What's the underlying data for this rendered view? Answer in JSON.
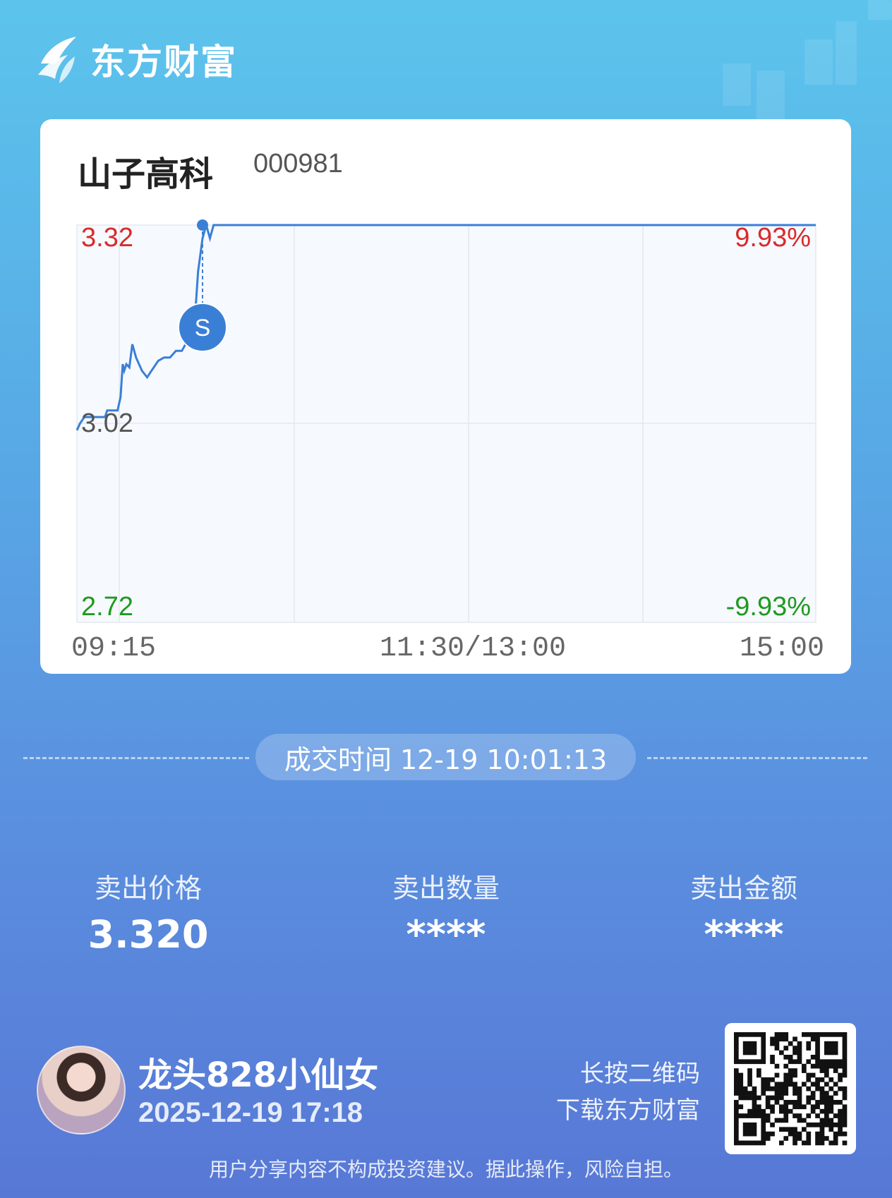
{
  "brand": {
    "name": "东方财富",
    "logo_icon": "eastmoney-logo-icon"
  },
  "stock": {
    "name": "山子高科",
    "code": "000981"
  },
  "chart_data": {
    "type": "line",
    "x_ticks": [
      "09:15",
      "11:30/13:00",
      "15:00"
    ],
    "y_left": {
      "high": "3.32",
      "mid": "3.02",
      "low": "2.72"
    },
    "y_right": {
      "high": "9.93%",
      "low": "-9.93%"
    },
    "ylim": [
      2.72,
      3.32
    ],
    "series": [
      {
        "points": [
          [
            0.0,
            3.01
          ],
          [
            0.004,
            3.02
          ],
          [
            0.01,
            3.03
          ],
          [
            0.038,
            3.03
          ],
          [
            0.041,
            3.04
          ],
          [
            0.055,
            3.04
          ],
          [
            0.059,
            3.06
          ],
          [
            0.062,
            3.11
          ],
          [
            0.064,
            3.1
          ],
          [
            0.067,
            3.11
          ],
          [
            0.071,
            3.105
          ],
          [
            0.075,
            3.14
          ],
          [
            0.08,
            3.12
          ],
          [
            0.088,
            3.1
          ],
          [
            0.095,
            3.09
          ],
          [
            0.101,
            3.1
          ],
          [
            0.11,
            3.115
          ],
          [
            0.118,
            3.12
          ],
          [
            0.126,
            3.12
          ],
          [
            0.134,
            3.13
          ],
          [
            0.142,
            3.13
          ],
          [
            0.152,
            3.15
          ],
          [
            0.158,
            3.15
          ],
          [
            0.164,
            3.25
          ],
          [
            0.17,
            3.3
          ],
          [
            0.175,
            3.32
          ],
          [
            0.18,
            3.3
          ],
          [
            0.185,
            3.32
          ],
          [
            0.19,
            3.32
          ],
          [
            1.0,
            3.32
          ]
        ],
        "color": "#3a7fd6"
      }
    ],
    "trade_marker": {
      "label": "S",
      "x": 0.17,
      "y": 3.32
    }
  },
  "deal": {
    "label": "成交时间 12-19 10:01:13"
  },
  "stats": [
    {
      "label": "卖出价格",
      "value": "3.320"
    },
    {
      "label": "卖出数量",
      "value": "****"
    },
    {
      "label": "卖出金额",
      "value": "****"
    }
  ],
  "user": {
    "name": "龙头828小仙女",
    "time": "2025-12-19 17:18"
  },
  "qr_hint": {
    "line1": "长按二维码",
    "line2": "下载东方财富"
  },
  "disclaimer": "用户分享内容不构成投资建议。据此操作，风险自担。"
}
